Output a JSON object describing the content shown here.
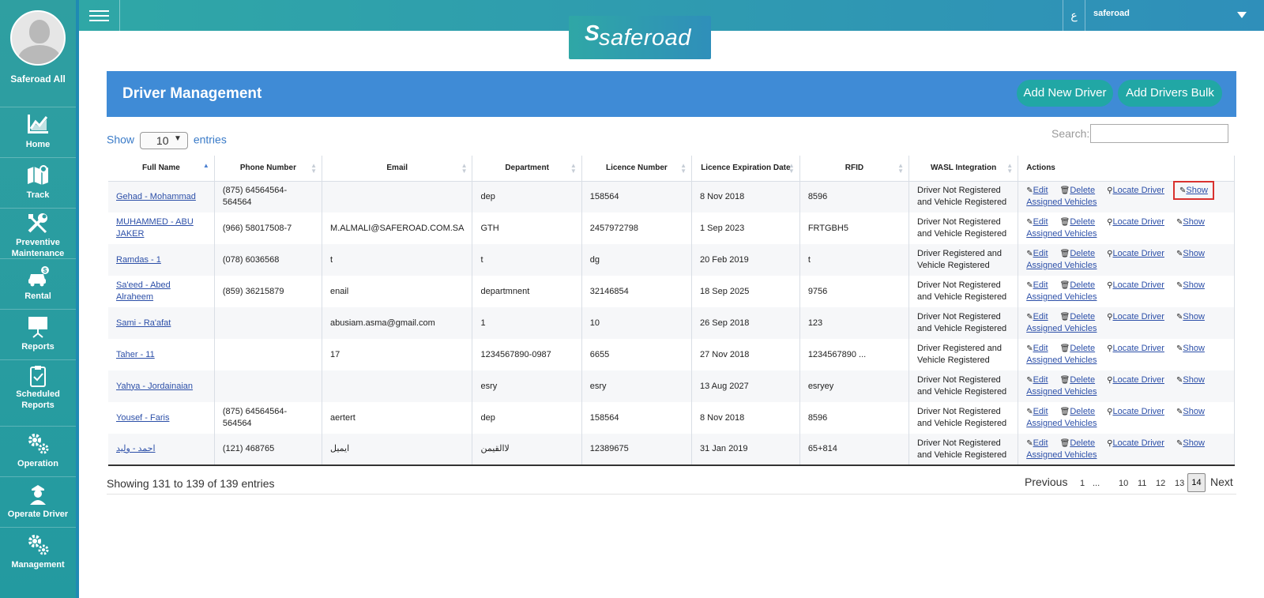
{
  "sidebar": {
    "profile_name": "Saferoad All",
    "items": [
      {
        "label": "Home"
      },
      {
        "label": "Track"
      },
      {
        "label": "Preventive Maintenance"
      },
      {
        "label": "Rental"
      },
      {
        "label": "Reports"
      },
      {
        "label": "Scheduled Reports"
      },
      {
        "label": "Operation"
      },
      {
        "label": "Operate Driver"
      },
      {
        "label": "Management"
      }
    ]
  },
  "topbar": {
    "lang": "ع",
    "user": "saferoad",
    "logo_text": "saferoad"
  },
  "panel": {
    "title": "Driver Management",
    "add_new": "Add New Driver",
    "add_bulk": "Add Drivers Bulk"
  },
  "controls": {
    "show": "Show",
    "entries_value": "10",
    "entries": "entries",
    "search_label": "Search:"
  },
  "table": {
    "headers": [
      "Full Name",
      "Phone Number",
      "Email",
      "Department",
      "Licence Number",
      "Licence Expiration Date",
      "RFID",
      "WASL Integration",
      "Actions"
    ],
    "actions": {
      "edit": "Edit",
      "delete": "Delete",
      "locate": "Locate Driver",
      "show": "Show",
      "assigned": "Assigned Vehicles"
    },
    "rows": [
      {
        "name": "Gehad - Mohammad",
        "phone": "(875) 64564564-564564",
        "email": "",
        "dept": "dep",
        "licence": "158564",
        "expiry": "8 Nov 2018",
        "rfid": "8596",
        "wasl": "Driver Not Registered and Vehicle Registered"
      },
      {
        "name": "MUHAMMED - ABU JAKER",
        "phone": "(966) 58017508-7",
        "email": "M.ALMALI@SAFEROAD.COM.SA",
        "dept": "GTH",
        "licence": "2457972798",
        "expiry": "1 Sep 2023",
        "rfid": "FRTGBH5",
        "wasl": "Driver Not Registered and Vehicle Registered"
      },
      {
        "name": "Ramdas - 1",
        "phone": "(078) 6036568",
        "email": "t",
        "dept": "t",
        "licence": "dg",
        "expiry": "20 Feb 2019",
        "rfid": "t",
        "wasl": "Driver Registered and Vehicle Registered"
      },
      {
        "name": "Sa'eed - Abed Alraheem",
        "phone": "(859) 36215879",
        "email": "enail",
        "dept": "departmnent",
        "licence": "32146854",
        "expiry": "18 Sep 2025",
        "rfid": "9756",
        "wasl": "Driver Not Registered and Vehicle Registered"
      },
      {
        "name": "Sami - Ra'afat",
        "phone": "",
        "email": "abusiam.asma@gmail.com",
        "dept": "1",
        "licence": "10",
        "expiry": "26 Sep 2018",
        "rfid": "123",
        "wasl": "Driver Not Registered and Vehicle Registered"
      },
      {
        "name": "Taher - 11",
        "phone": "",
        "email": "17",
        "dept": "1234567890-0987",
        "licence": "6655",
        "expiry": "27 Nov 2018",
        "rfid": "1234567890 ...",
        "wasl": "Driver Registered and Vehicle Registered"
      },
      {
        "name": "Yahya - Jordainaian",
        "phone": "",
        "email": "",
        "dept": "esry",
        "licence": "esry",
        "expiry": "13 Aug 2027",
        "rfid": "esryey",
        "wasl": "Driver Not Registered and Vehicle Registered"
      },
      {
        "name": "Yousef - Faris",
        "phone": "(875) 64564564-564564",
        "email": "aertert",
        "dept": "dep",
        "licence": "158564",
        "expiry": "8 Nov 2018",
        "rfid": "8596",
        "wasl": "Driver Not Registered and Vehicle Registered"
      },
      {
        "name": "احمد - وليد",
        "phone": "(121) 468765",
        "email": "ايميل",
        "dept": "لاالقيمن",
        "licence": "12389675",
        "expiry": "31 Jan 2019",
        "rfid": "65+814",
        "wasl": "Driver Not Registered and Vehicle Registered"
      }
    ]
  },
  "footer": {
    "info": "Showing 131 to 139 of 139 entries",
    "previous": "Previous",
    "next": "Next",
    "pages": [
      "1",
      "...",
      "10",
      "11",
      "12",
      "13",
      "14"
    ],
    "current_page": "14"
  },
  "colors": {
    "accent": "#21a7a5",
    "header_blue": "#3f8bd6",
    "highlight": "#d9322f"
  }
}
